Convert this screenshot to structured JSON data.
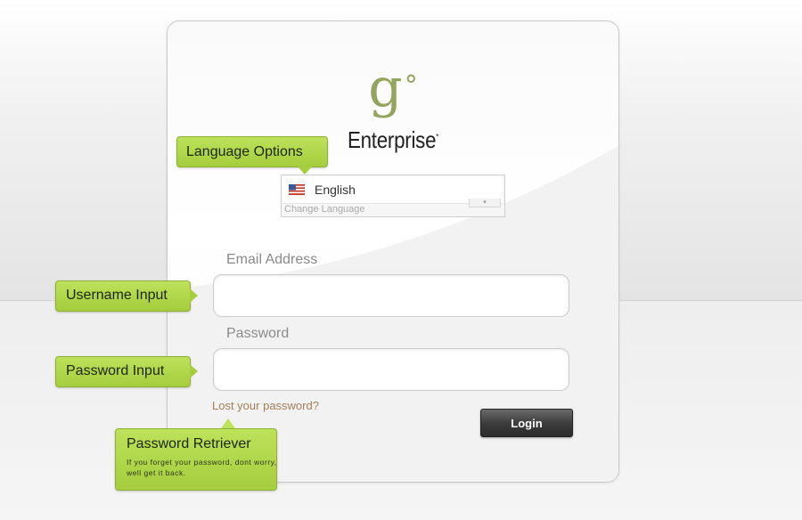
{
  "brand": {
    "mark": "g",
    "mark_degree": "°",
    "name": "Enterprise",
    "trademark": "*"
  },
  "language": {
    "selected": "English",
    "hint": "Change Language",
    "flag_icon": "us-flag-icon"
  },
  "form": {
    "email_label": "Email Address",
    "email_value": "",
    "password_label": "Password",
    "password_value": "",
    "lost_password_link": "Lost your password?",
    "login_button": "Login"
  },
  "callouts": {
    "language": "Language Options",
    "username": "Username Input",
    "password": "Password Input",
    "retriever_title": "Password Retriever",
    "retriever_desc": "If you forget your password, dont worry, well get it back."
  },
  "colors": {
    "callout_green": "#a5cd3d",
    "logo_green": "#93a55d",
    "link_brown": "#a27f5a",
    "button_dark": "#3d3d3d"
  }
}
